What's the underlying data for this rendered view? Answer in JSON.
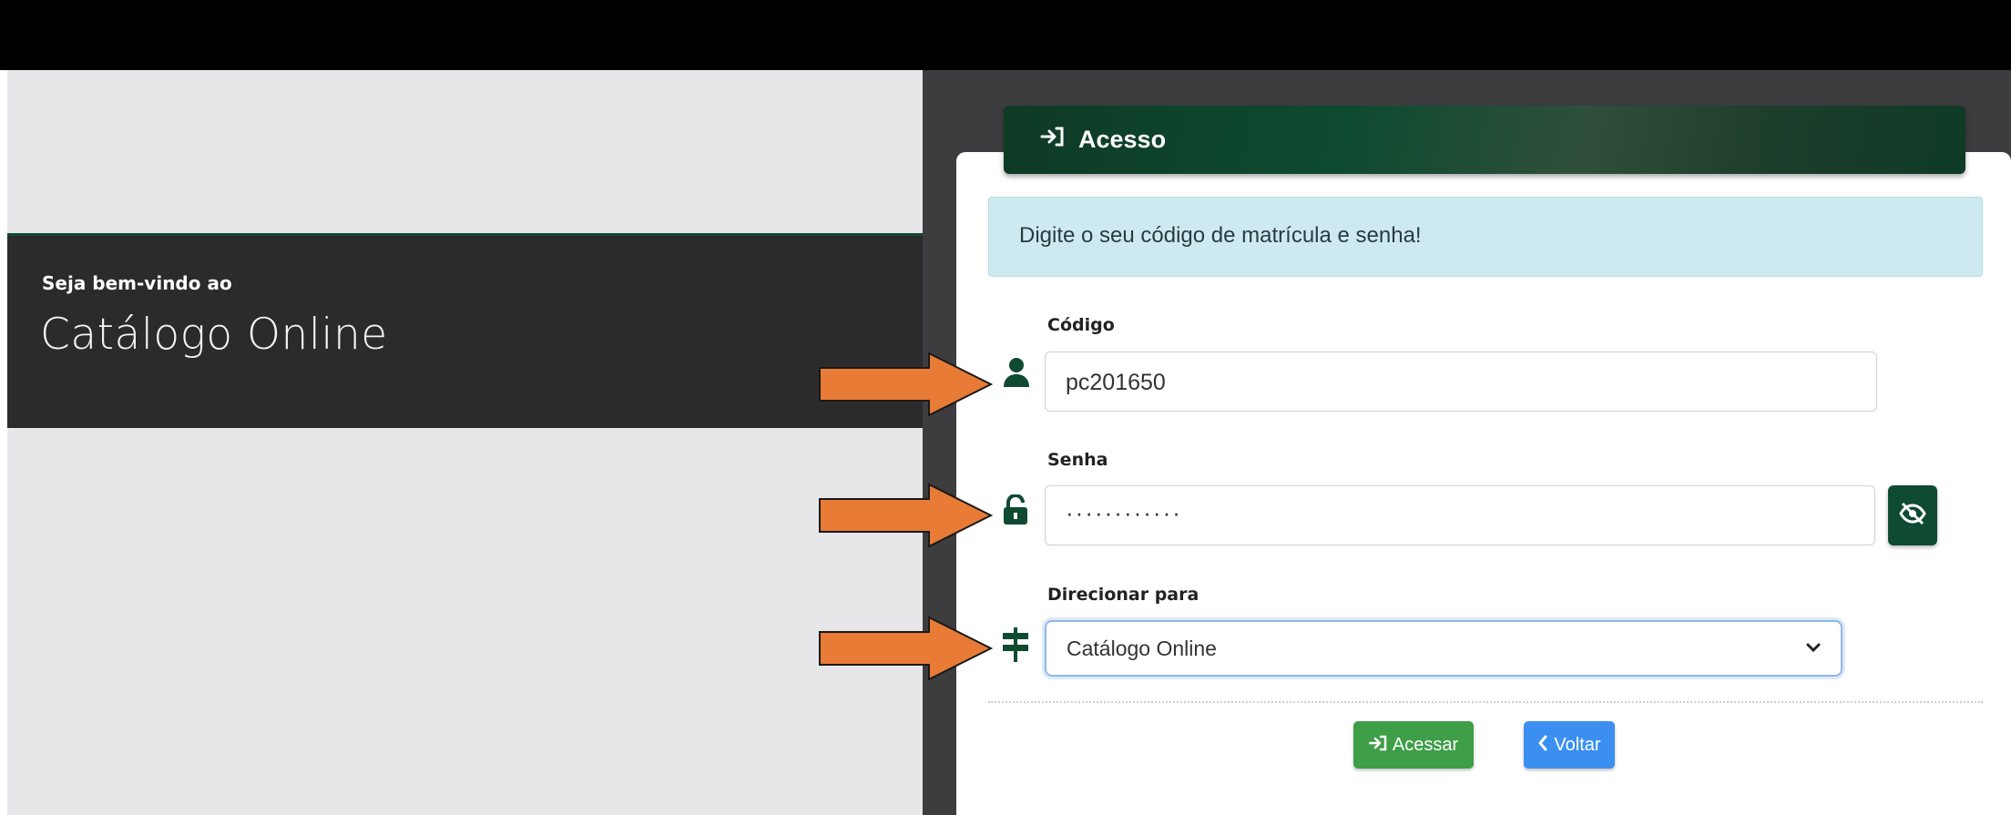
{
  "welcome": {
    "subtitle": "Seja bem-vindo ao",
    "title": "Catálogo Online"
  },
  "card": {
    "header_title": "Acesso",
    "alert_text": "Digite o seu código de matrícula e senha!"
  },
  "form": {
    "codigo_label": "Código",
    "codigo_value": "pc201650",
    "senha_label": "Senha",
    "senha_value": "············",
    "direcionar_label": "Direcionar para",
    "direcionar_value": "Catálogo Online"
  },
  "buttons": {
    "acessar_label": "Acessar",
    "voltar_label": "Voltar"
  },
  "icons": {
    "header": "sign-in-icon",
    "codigo": "user-icon",
    "senha": "unlock-icon",
    "direcionar": "signpost-icon",
    "toggle_password": "eye-slash-icon",
    "voltar": "chevron-left-icon"
  },
  "colors": {
    "brand_green": "#0f4a32",
    "acessar_green": "#3f9e48",
    "voltar_blue": "#3a8ff0",
    "alert_bg": "#cdeaf0",
    "annotation_arrow": "#e87b35"
  }
}
